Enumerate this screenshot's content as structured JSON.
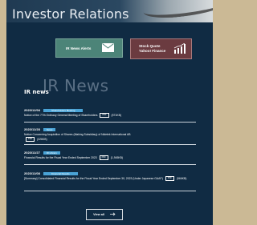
{
  "header": {
    "title": "Investor Relations"
  },
  "buttons": {
    "alerts_label": "IR News Alerts",
    "stock_label_line1": "Stock Quote",
    "stock_label_line2": "Yahoo! Finance",
    "alerts_icon": "mail-icon",
    "stock_icon": "stock-chart-icon",
    "colors": {
      "alerts_bg": "#4c8478",
      "stock_bg": "#6b3b40"
    }
  },
  "news": {
    "heading_bg": "IR News",
    "heading_fg": "IR news",
    "items": [
      {
        "date": "2023/12/04",
        "tag": "Shareholders Meeting",
        "title": "Notice of the 77th Ordinary General Meeting of Shareholders",
        "badge": "PDF",
        "size": "(571KB)"
      },
      {
        "date": "2023/11/28",
        "tag": "News",
        "title": "Notice Concerning Acquisition of Shares (Making Subsidiary) of Nidetek International AB",
        "badge": "PDF",
        "size": "(326KB)"
      },
      {
        "date": "2023/11/27",
        "tag": "IR Library",
        "title": "Financial Results for the Fiscal Year Ended September 2023",
        "badge": "PDF",
        "size": "(1,945KB)"
      },
      {
        "date": "2023/11/08",
        "tag": "Financial Results",
        "title": "[Summary] Consolidated Financial Results for the Fiscal Year Ended September 30, 2023 (Under Japanese GAAP)",
        "badge": "PDF",
        "size": "(566KB)"
      }
    ],
    "view_all": "View all",
    "colors": {
      "tag": "#4aa3d6"
    }
  }
}
